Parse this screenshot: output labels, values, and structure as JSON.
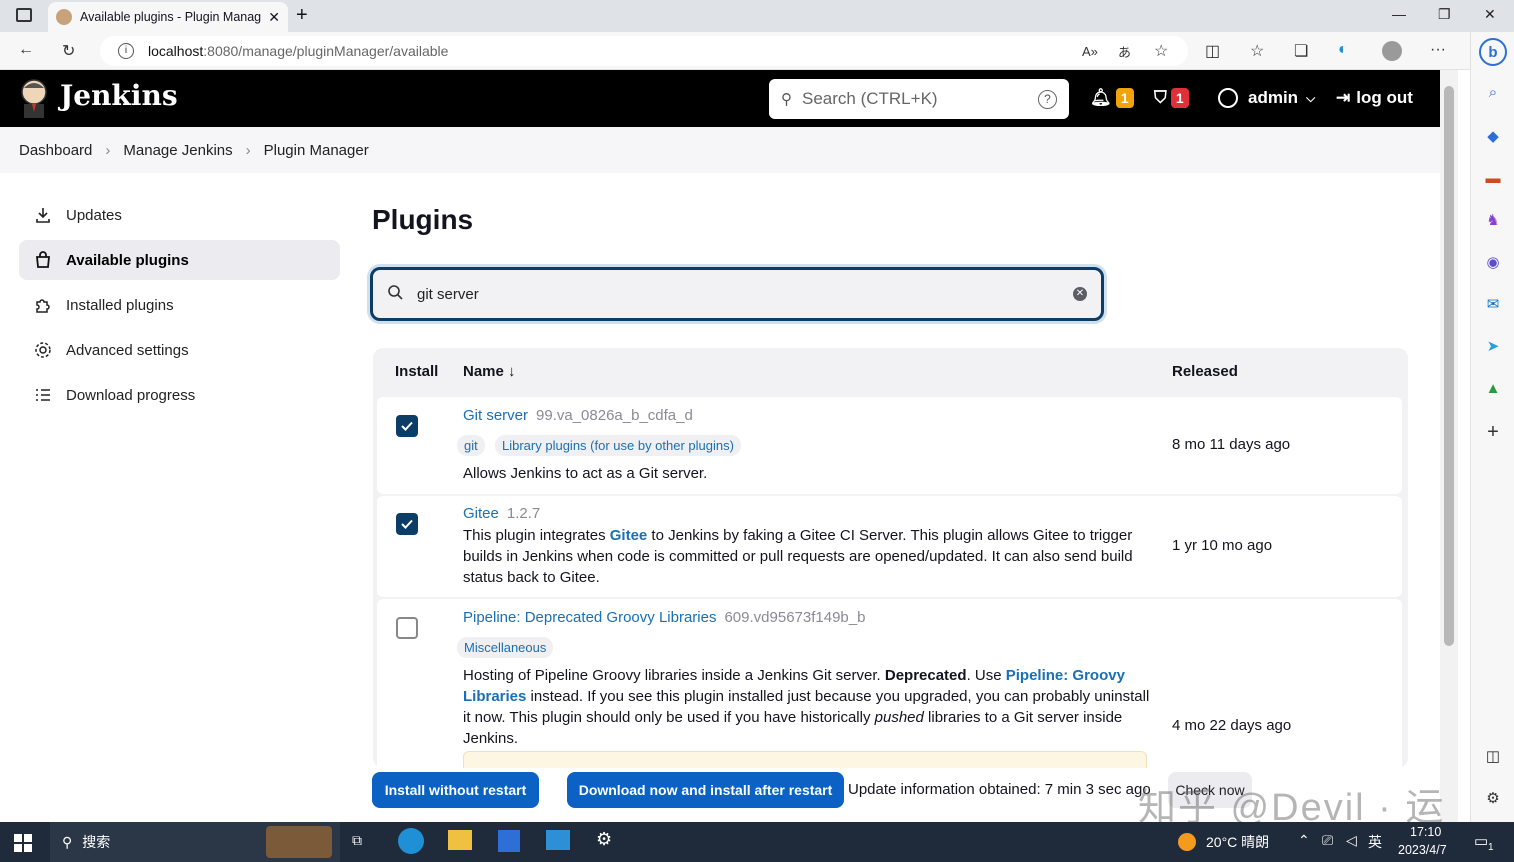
{
  "browser": {
    "tab_title": "Available plugins - Plugin Manag",
    "url_host": "localhost",
    "url_rest": ":8080/manage/pluginManager/available"
  },
  "header": {
    "brand": "Jenkins",
    "search_placeholder": "Search (CTRL+K)",
    "notifications_count": "1",
    "security_count": "1",
    "user": "admin",
    "logout": "log out"
  },
  "breadcrumb": [
    "Dashboard",
    "Manage Jenkins",
    "Plugin Manager"
  ],
  "sidebar": {
    "items": [
      {
        "label": "Updates"
      },
      {
        "label": "Available plugins"
      },
      {
        "label": "Installed plugins"
      },
      {
        "label": "Advanced settings"
      },
      {
        "label": "Download progress"
      }
    ]
  },
  "main": {
    "title": "Plugins",
    "filter_value": "git server",
    "columns": {
      "install": "Install",
      "name": "Name ↓",
      "released": "Released"
    },
    "plugins": [
      {
        "name": "Git server",
        "version": "99.va_0826a_b_cdfa_d",
        "checked": true,
        "tags": [
          "git",
          "Library plugins (for use by other plugins)"
        ],
        "desc": "Allows Jenkins to act as a Git server.",
        "released": "8 mo 11 days ago"
      },
      {
        "name": "Gitee",
        "version": "1.2.7",
        "checked": true,
        "tags": [],
        "desc_pre": "This plugin integrates ",
        "desc_link": "Gitee",
        "desc_post": " to Jenkins by faking a Gitee CI Server. This plugin allows Gitee to trigger builds in Jenkins when code is committed or pull requests are opened/updated. It can also send build status back to Gitee.",
        "released": "1 yr 10 mo ago"
      },
      {
        "name": "Pipeline: Deprecated Groovy Libraries",
        "version": "609.vd95673f149b_b",
        "checked": false,
        "tags": [
          "Miscellaneous"
        ],
        "desc_pre": "Hosting of Pipeline Groovy libraries inside a Jenkins Git server. ",
        "desc_bold": "Deprecated",
        "desc_mid": ". Use ",
        "desc_link": "Pipeline: Groovy Libraries",
        "desc_mid2": " instead. If you see this plugin installed just because you upgraded, you can probably uninstall it now. This plugin should only be used if you have historically ",
        "desc_em": "pushed",
        "desc_post": " libraries to a Git server inside Jenkins.",
        "released": "4 mo 22 days ago"
      }
    ]
  },
  "footer": {
    "install_without_restart": "Install without restart",
    "download_and_install": "Download now and install after restart",
    "update_info": "Update information obtained: 7 min 3 sec ago",
    "check_now": "Check now"
  },
  "watermark": "知乎 @Devil · 运",
  "taskbar": {
    "search": "搜索",
    "weather": "20°C 晴朗",
    "ime": "英",
    "time": "17:10",
    "date": "2023/4/7",
    "notifications": "1"
  }
}
